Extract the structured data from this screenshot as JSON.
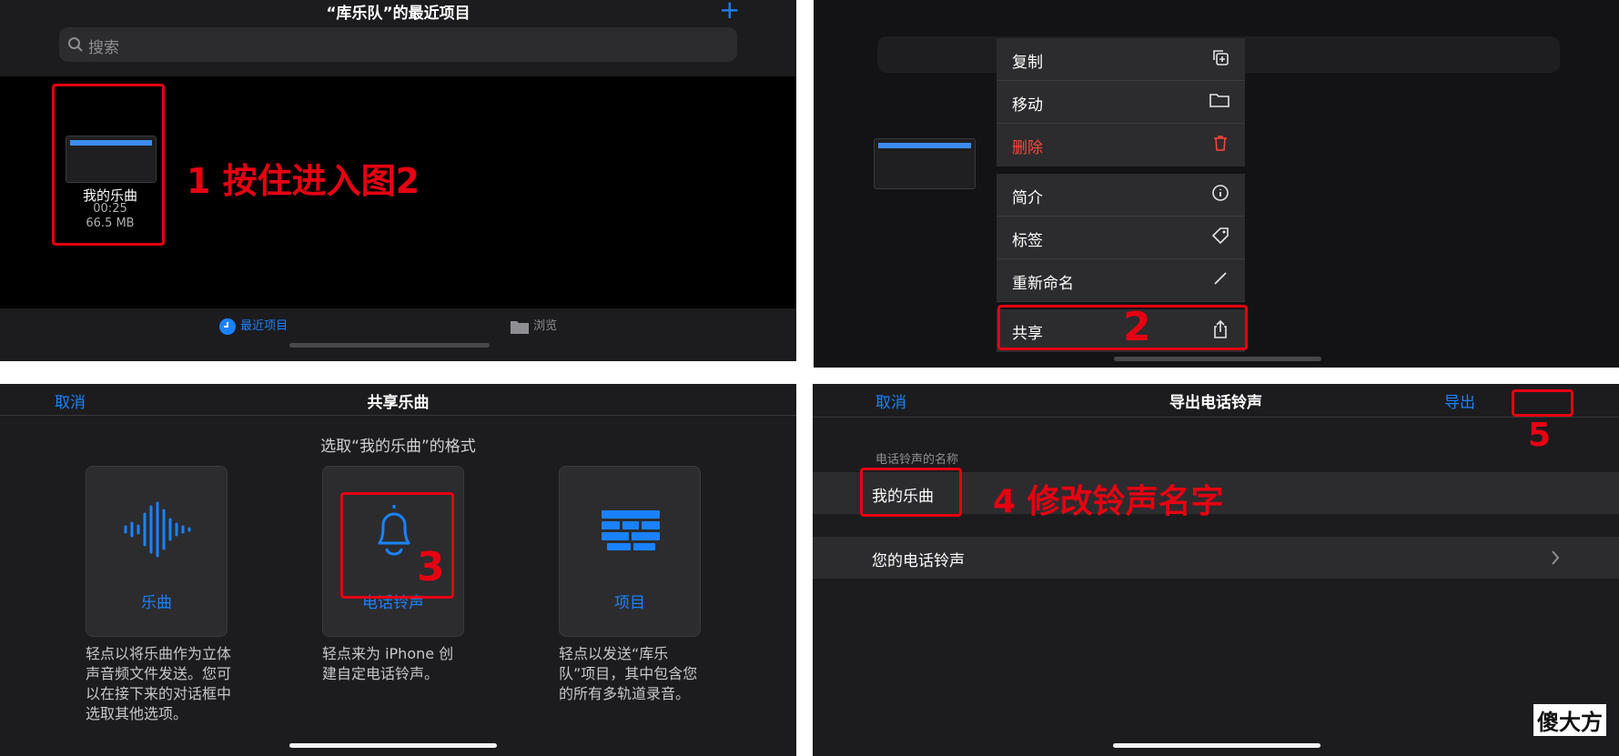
{
  "panel1": {
    "title": "“库乐队”的最近项目",
    "search_placeholder": "搜索",
    "file": {
      "name": "我的乐曲",
      "duration": "00:25",
      "size": "66.5 MB"
    },
    "annotation": "1 按住进入图2",
    "tabs": [
      {
        "label": "最近项目",
        "active": true
      },
      {
        "label": "浏览",
        "active": false
      }
    ]
  },
  "panel2": {
    "menu": [
      {
        "label": "复制",
        "icon": "duplicate-icon"
      },
      {
        "label": "移动",
        "icon": "folder-icon"
      },
      {
        "label": "删除",
        "icon": "trash-icon",
        "color": "#ff453a"
      },
      {
        "label": "简介",
        "icon": "info-icon"
      },
      {
        "label": "标签",
        "icon": "tag-icon"
      },
      {
        "label": "重新命名",
        "icon": "pencil-icon"
      },
      {
        "label": "共享",
        "icon": "share-icon"
      }
    ],
    "annotation": "2"
  },
  "panel3": {
    "cancel": "取消",
    "title": "共享乐曲",
    "subtitle": "选取“我的乐曲”的格式",
    "options": [
      {
        "label": "乐曲",
        "icon": "waveform-icon",
        "desc": "轻点以将乐曲作为立体声音频文件发送。您可以在接下来的对话框中选取其他选项。"
      },
      {
        "label": "电话铃声",
        "icon": "bell-icon",
        "desc": "轻点来为 iPhone 创建自定电话铃声。"
      },
      {
        "label": "项目",
        "icon": "tracks-icon",
        "desc": "轻点以发送“库乐队”项目，其中包含您的所有多轨道录音。"
      }
    ],
    "annotation": "3"
  },
  "panel4": {
    "cancel": "取消",
    "title": "导出电话铃声",
    "export": "导出",
    "caption": "电话铃声的名称",
    "name_value": "我的乐曲",
    "your_ringtones": "您的电话铃声",
    "annotation4": "4 修改铃声名字",
    "annotation5": "5"
  },
  "watermark": "傻大方",
  "colors": {
    "accent": "#1a82ff",
    "annotation": "#e60012",
    "destructive": "#ff453a"
  }
}
